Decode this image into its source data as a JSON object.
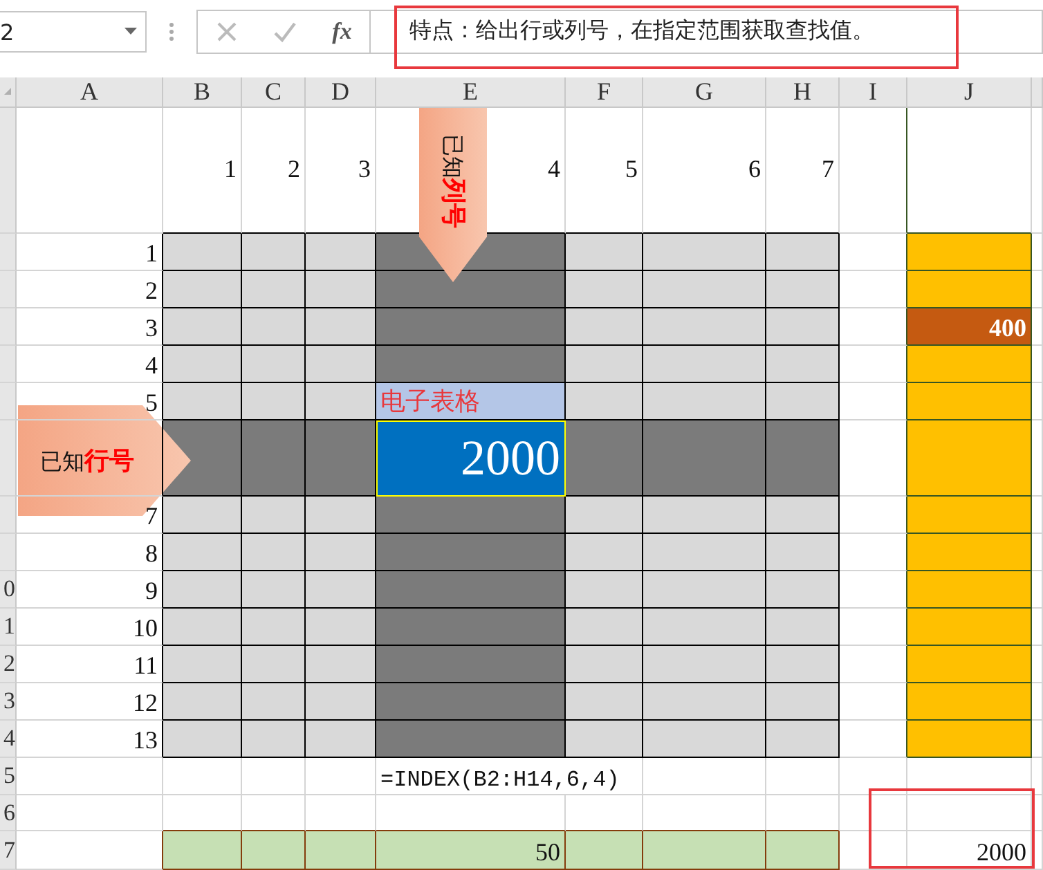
{
  "formula_bar": {
    "name_box": "2",
    "function_label": "fx",
    "formula": "特点：给出行或列号，在指定范围获取查找值。",
    "highlighted": true
  },
  "columns": [
    "A",
    "B",
    "C",
    "D",
    "E",
    "F",
    "G",
    "H",
    "I",
    "J"
  ],
  "column_numbers": [
    {
      "label": "1",
      "highlighted": false
    },
    {
      "label": "2",
      "highlighted": false
    },
    {
      "label": "3",
      "highlighted": false
    },
    {
      "label": "4",
      "highlighted": true
    },
    {
      "label": "5",
      "highlighted": false
    },
    {
      "label": "6",
      "highlighted": false
    },
    {
      "label": "7",
      "highlighted": false
    }
  ],
  "rows": [
    {
      "label": "1",
      "highlighted": false,
      "side_selected": false
    },
    {
      "label": "2",
      "highlighted": false,
      "side_selected": false
    },
    {
      "label": "3",
      "highlighted": false,
      "side_selected": true,
      "side_value": "400"
    },
    {
      "label": "4",
      "highlighted": false,
      "side_selected": false
    },
    {
      "label": "5",
      "highlighted": false,
      "side_selected": false,
      "note": "电子表格"
    },
    {
      "highlighted": true,
      "side_selected": false,
      "result": "2000"
    },
    {
      "label": "7",
      "highlighted": false,
      "side_selected": false
    },
    {
      "label": "8",
      "highlighted": false,
      "side_selected": false
    },
    {
      "label": "9",
      "highlighted": false,
      "side_selected": false,
      "row_header": "0"
    },
    {
      "label": "10",
      "highlighted": false,
      "side_selected": false,
      "row_header": "1"
    },
    {
      "label": "11",
      "highlighted": false,
      "side_selected": false,
      "row_header": "2"
    },
    {
      "label": "12",
      "highlighted": false,
      "side_selected": false,
      "row_header": "3"
    },
    {
      "label": "13",
      "highlighted": false,
      "side_selected": false,
      "row_header": "4"
    }
  ],
  "callouts": [
    {
      "kind": "column",
      "text": "已知**列号**"
    },
    {
      "kind": "row",
      "text": "已知**行号**"
    }
  ],
  "formula_note": "=INDEX(B2:H14,6,4)",
  "footer_row_headers": [
    "5",
    "6",
    "7"
  ],
  "totals": {
    "value": "50"
  },
  "result": {
    "value": "2000",
    "highlighted": true
  }
}
